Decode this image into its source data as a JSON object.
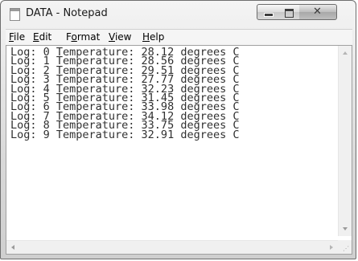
{
  "window": {
    "title": "DATA - Notepad"
  },
  "menu": {
    "items": [
      {
        "label": "File",
        "mnemonic": "F",
        "rest": "ile"
      },
      {
        "label": "Edit",
        "mnemonic": "E",
        "rest": "dit"
      },
      {
        "label": "Format",
        "pre": "F",
        "mnemonic": "o",
        "rest": "rmat"
      },
      {
        "label": "View",
        "mnemonic": "V",
        "rest": "iew"
      },
      {
        "label": "Help",
        "mnemonic": "H",
        "rest": "elp"
      }
    ]
  },
  "editor": {
    "lines": [
      "Log: 0 Temperature: 28.12 degrees C",
      "Log: 1 Temperature: 28.56 degrees C",
      "Log: 2 Temperature: 29.51 degrees C",
      "Log: 3 Temperature: 27.77 degrees C",
      "Log: 4 Temperature: 32.23 degrees C",
      "Log: 5 Temperature: 31.45 degrees C",
      "Log: 6 Temperature: 33.98 degrees C",
      "Log: 7 Temperature: 34.12 degrees C",
      "Log: 8 Temperature: 33.75 degrees C",
      "Log: 9 Temperature: 32.91 degrees C"
    ]
  },
  "icons": {
    "app": "notepad-icon",
    "minimize": "minimize-icon",
    "maximize": "maximize-icon",
    "close": "close-icon",
    "size_grip": "resize-grip-icon"
  },
  "colors": {
    "text": "#303030",
    "chrome": "#d9d9d9",
    "editor_bg": "#ffffff"
  }
}
